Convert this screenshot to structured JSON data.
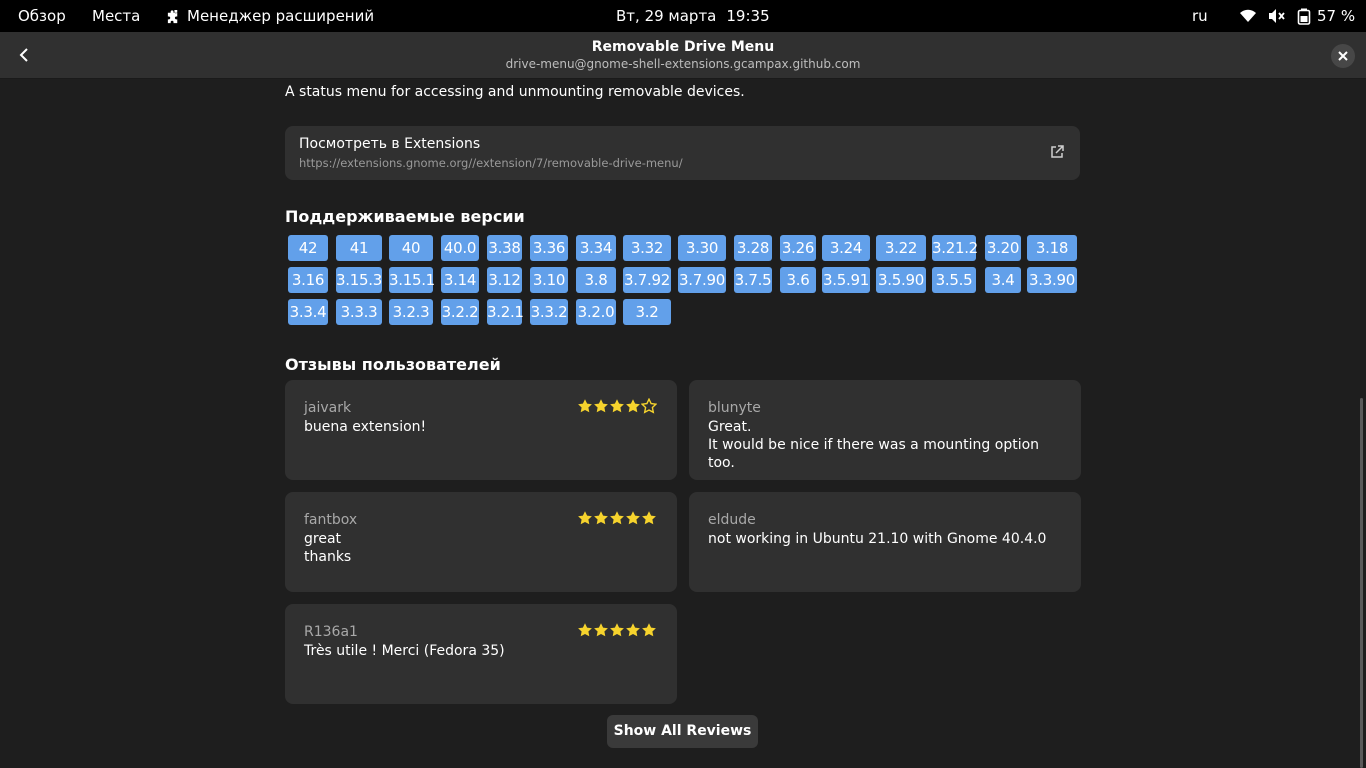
{
  "topbar": {
    "overview": "Обзор",
    "places": "Места",
    "app_name": "Менеджер расширений",
    "date": "Вт, 29 марта",
    "time": "19:35",
    "language": "ru",
    "battery": "57 %",
    "icons": [
      "puzzle-icon",
      "wifi-icon",
      "volume-muted-icon",
      "battery-icon"
    ]
  },
  "header": {
    "title": "Removable Drive Menu",
    "subtitle": "drive-menu@gnome-shell-extensions.gcampax.github.com"
  },
  "description": "A status menu for accessing and unmounting removable devices.",
  "link": {
    "title": "Посмотреть в Extensions",
    "url": "https://extensions.gnome.org//extension/7/removable-drive-menu/"
  },
  "versions": {
    "title": "Поддерживаемые версии",
    "items": [
      "42",
      "41",
      "40",
      "40.0",
      "3.38",
      "3.36",
      "3.34",
      "3.32",
      "3.30",
      "3.28",
      "3.26",
      "3.24",
      "3.22",
      "3.21.2",
      "3.20",
      "3.18",
      "3.16",
      "3.15.3",
      "3.15.1",
      "3.14",
      "3.12",
      "3.10",
      "3.8",
      "3.7.92",
      "3.7.90",
      "3.7.5",
      "3.6",
      "3.5.91",
      "3.5.90",
      "3.5.5",
      "3.4",
      "3.3.90",
      "3.3.4",
      "3.3.3",
      "3.2.3",
      "3.2.2",
      "3.2.1",
      "3.3.2",
      "3.2.0",
      "3.2"
    ]
  },
  "reviews": {
    "title": "Отзывы пользователей",
    "items": [
      {
        "author": "jaivark",
        "text": "buena extension!",
        "rating": 4
      },
      {
        "author": "blunyte",
        "text": "Great.\nIt would be nice if there was a mounting option too.",
        "rating": null
      },
      {
        "author": "fantbox",
        "text": "great\nthanks",
        "rating": 5
      },
      {
        "author": "eldude",
        "text": "not working in Ubuntu 21.10 with Gnome 40.4.0",
        "rating": null
      },
      {
        "author": "R136a1",
        "text": "Très utile ! Merci (Fedora 35)",
        "rating": 5
      }
    ],
    "show_all_label": "Show All Reviews"
  },
  "colors": {
    "accent": "#62a0ea",
    "star": "#f6d32d",
    "card": "#303030",
    "background": "#1e1e1e"
  }
}
